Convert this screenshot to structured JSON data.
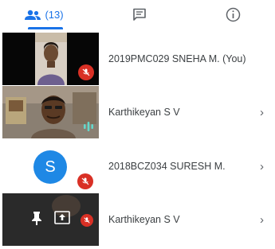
{
  "tabs": {
    "people_count": "(13)",
    "people_icon": "people-icon",
    "chat_icon": "chat-icon",
    "info_icon": "info-icon",
    "accent": "#1a73e8"
  },
  "participants": [
    {
      "name": "2019PMC029 SNEHA M. (You)",
      "mic": "muted"
    },
    {
      "name": "Karthikeyan S V",
      "mic": "speaking"
    },
    {
      "name": "2018BCZ034 SURESH M.",
      "avatar_letter": "S",
      "mic": "muted"
    },
    {
      "name": "Karthikeyan S V",
      "mic": "muted",
      "presenting": true
    }
  ],
  "colors": {
    "mic_off": "#d93025",
    "avatar": "#1e88e5",
    "speaking": "#64d8cb"
  }
}
